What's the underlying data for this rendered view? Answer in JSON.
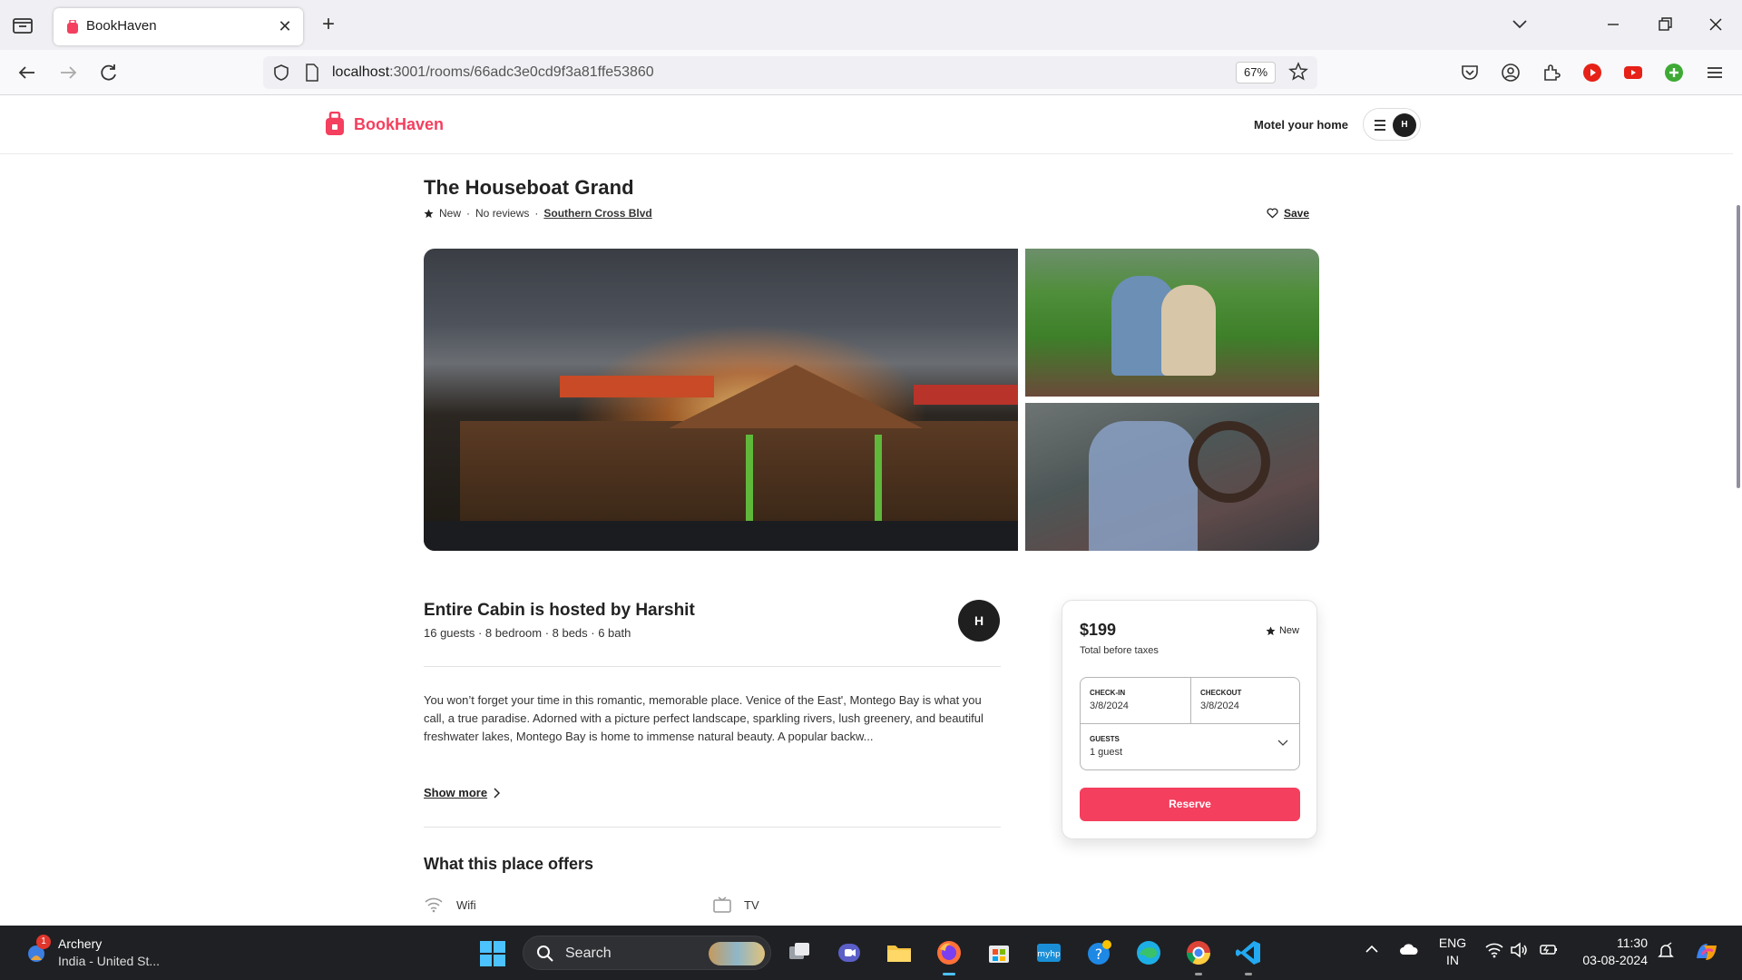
{
  "browser": {
    "tab_title": "BookHaven",
    "url_host": "localhost",
    "url_path": ":3001/rooms/66adc3e0cd9f3a81ffe53860",
    "zoom": "67%"
  },
  "site": {
    "brand": "BookHaven",
    "brand_color": "#f43f5e",
    "host_link": "Motel your home",
    "avatar_initial": "H"
  },
  "listing": {
    "title": "The Houseboat Grand",
    "rating_label": "New",
    "reviews": "No reviews",
    "location": "Southern Cross Blvd",
    "save_label": "Save",
    "host_title": "Entire Cabin is hosted by Harshit",
    "host_stats": "16 guests · 8 bedroom · 8 beds · 6 bath",
    "host_initial": "H",
    "description": "You won’t forget your time in this romantic, memorable place. Venice of the East', Montego Bay is what you call, a true paradise. Adorned with a picture perfect landscape, sparkling rivers, lush greenery, and beautiful freshwater lakes, Montego Bay is home to immense natural beauty. A popular backw...",
    "show_more": "Show more",
    "offers_title": "What this place offers",
    "amenities": [
      {
        "icon": "wifi-icon",
        "label": "Wifi"
      },
      {
        "icon": "tv-icon",
        "label": "TV"
      }
    ]
  },
  "booking": {
    "price": "$199",
    "price_note": "Total before taxes",
    "rating": "New",
    "checkin_label": "CHECK-IN",
    "checkin_value": "3/8/2024",
    "checkout_label": "CHECKOUT",
    "checkout_value": "3/8/2024",
    "guests_label": "GUESTS",
    "guests_value": "1 guest",
    "reserve_label": "Reserve"
  },
  "taskbar": {
    "weather_title": "Archery",
    "weather_sub": "India - United St...",
    "notification_count": "1",
    "search_placeholder": "Search",
    "lang_line1": "ENG",
    "lang_line2": "IN",
    "time": "11:30",
    "date": "03-08-2024"
  }
}
